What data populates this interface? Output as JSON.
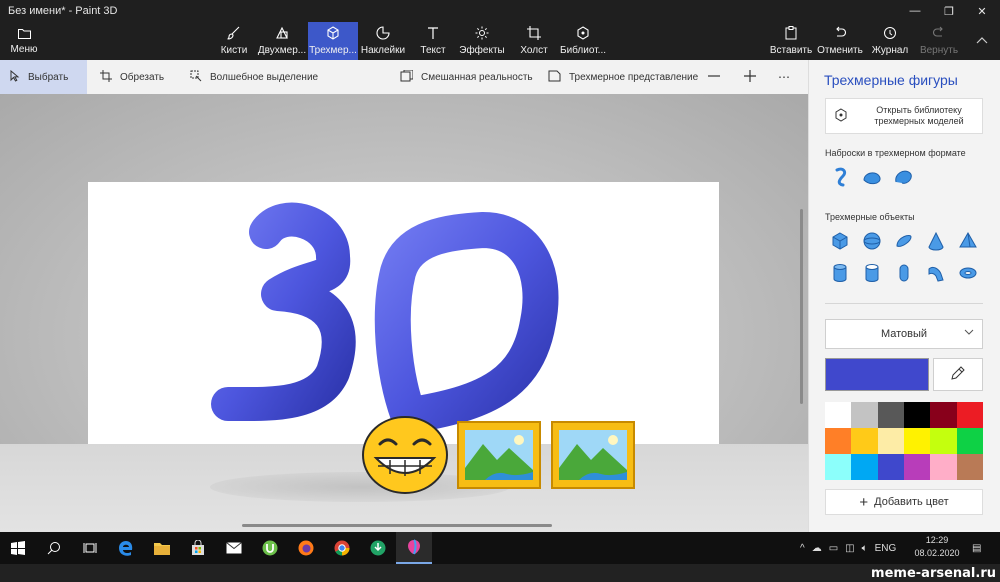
{
  "window": {
    "title": "Без имени* - Paint 3D"
  },
  "ribbon": {
    "menu": "Меню",
    "tools": [
      {
        "label": "Кисти",
        "icon": "brush-icon"
      },
      {
        "label": "Двухмер...",
        "icon": "shapes-2d-icon"
      },
      {
        "label": "Трехмер...",
        "icon": "cube-icon",
        "active": true
      },
      {
        "label": "Наклейки",
        "icon": "sticker-icon"
      },
      {
        "label": "Текст",
        "icon": "text-icon"
      },
      {
        "label": "Эффекты",
        "icon": "sun-icon"
      },
      {
        "label": "Холст",
        "icon": "canvas-crop-icon"
      },
      {
        "label": "Библиот...",
        "icon": "library-icon"
      }
    ],
    "actions": {
      "paste": "Вставить",
      "undo": "Отменить",
      "history": "Журнал",
      "redo": "Вернуть"
    }
  },
  "toolbar": {
    "select": "Выбрать",
    "crop": "Обрезать",
    "magic_select": "Волшебное выделение",
    "mixed_reality": "Смешанная реальность",
    "view_3d": "Трехмерное представление"
  },
  "canvas": {
    "text_3d": "3D"
  },
  "panel": {
    "title": "Трехмерные фигуры",
    "open_library": "Открыть библиотеку трехмерных моделей",
    "doodle_section": "Наброски в трехмерном формате",
    "objects_section": "Трехмерные объекты",
    "material": "Матовый",
    "current_color": "#4048cc",
    "palette": [
      "#ffffff",
      "#c3c3c3",
      "#585858",
      "#000000",
      "#88001b",
      "#ec1c24",
      "#ff7f27",
      "#ffca18",
      "#fdeca6",
      "#fff200",
      "#c4ff0e",
      "#0ed145",
      "#8cfffb",
      "#00a8f3",
      "#3f48cc",
      "#b83dba",
      "#ffaec8",
      "#b97a56"
    ],
    "add_color": "Добавить цвет"
  },
  "taskbar": {
    "lang": "ENG",
    "time": "12:29",
    "date": "08.02.2020"
  },
  "watermark": "meme-arsenal.ru"
}
